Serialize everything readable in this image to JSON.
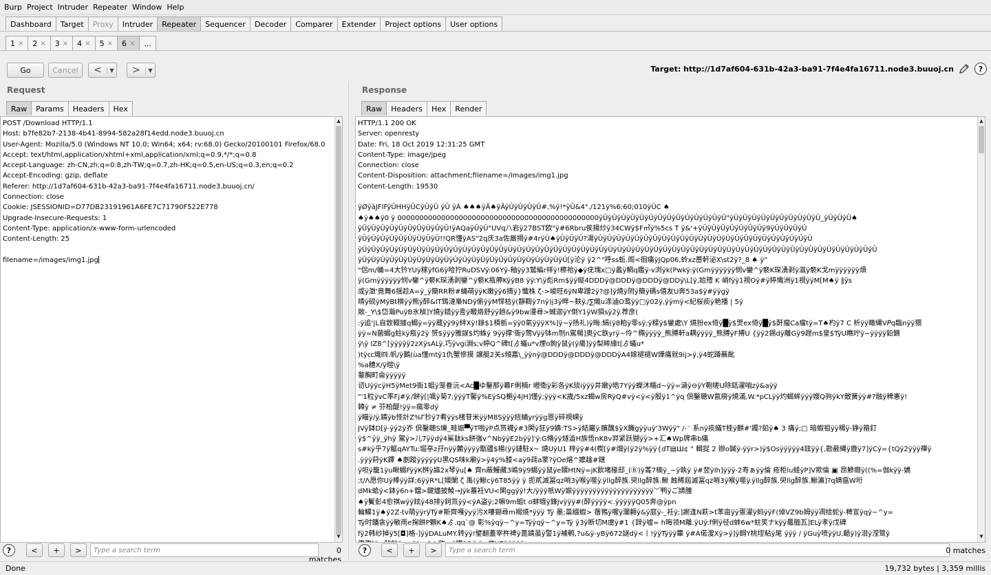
{
  "menu": [
    "Burp",
    "Project",
    "Intruder",
    "Repeater",
    "Window",
    "Help"
  ],
  "main_tabs": [
    {
      "label": "Dashboard",
      "active": false,
      "disabled": false
    },
    {
      "label": "Target",
      "active": false,
      "disabled": false
    },
    {
      "label": "Proxy",
      "active": false,
      "disabled": true
    },
    {
      "label": "Intruder",
      "active": false,
      "disabled": false
    },
    {
      "label": "Repeater",
      "active": true,
      "disabled": false
    },
    {
      "label": "Sequencer",
      "active": false,
      "disabled": false
    },
    {
      "label": "Decoder",
      "active": false,
      "disabled": false
    },
    {
      "label": "Comparer",
      "active": false,
      "disabled": false
    },
    {
      "label": "Extender",
      "active": false,
      "disabled": false
    },
    {
      "label": "Project options",
      "active": false,
      "disabled": false
    },
    {
      "label": "User options",
      "active": false,
      "disabled": false
    }
  ],
  "repeater_tabs": [
    {
      "label": "1",
      "close": "×",
      "active": false
    },
    {
      "label": "2",
      "close": "×",
      "active": false
    },
    {
      "label": "3",
      "close": "×",
      "active": false
    },
    {
      "label": "4",
      "close": "×",
      "active": false
    },
    {
      "label": "5",
      "close": "×",
      "active": false
    },
    {
      "label": "6",
      "close": "×",
      "active": true
    },
    {
      "label": "...",
      "close": "",
      "active": false
    }
  ],
  "toolbar": {
    "go_label": "Go",
    "cancel_label": "Cancel",
    "back_arrow": "<",
    "forward_arrow": ">",
    "dropdown_glyph": "▼",
    "target_text": "Target: http://1d7af604-631b-42a3-ba91-7f4e4fa16711.node3.buuoj.cn",
    "help_glyph": "?"
  },
  "request": {
    "title": "Request",
    "tabs": [
      "Raw",
      "Params",
      "Headers",
      "Hex"
    ],
    "lines": [
      "POST /Download HTTP/1.1",
      "Host: b7fe82b7-2138-4b41-8994-582a28f14edd.node3.buuoj.cn",
      "User-Agent: Mozilla/5.0 (Windows NT 10.0; Win64; x64; rv:68.0) Gecko/20100101 Firefox/68.0",
      "Accept: text/html,application/xhtml+xml,application/xml;q=0.9,*/*;q=0.8",
      "Accept-Language: zh-CN,zh;q=0.8,zh-TW;q=0.7,zh-HK;q=0.5,en-US;q=0.3,en;q=0.2",
      "Accept-Encoding: gzip, deflate",
      "Referer: http://1d7af604-631b-42a3-ba91-7f4e4fa16711.node3.buuoj.cn/",
      "Connection: close",
      "Cookie: JSESSIONID=D77DB23191961A6FE7C71790F522E778",
      "Upgrade-Insecure-Requests: 1",
      "Content-Type: application/x-www-form-urlencoded",
      "Content-Length: 25",
      "",
      "filename=/images/img1.jpg"
    ],
    "search_placeholder": "Type a search term",
    "matches": "0 matches"
  },
  "response": {
    "title": "Response",
    "tabs": [
      "Raw",
      "Headers",
      "Hex",
      "Render"
    ],
    "lines": [
      "HTTP/1.1 200 OK",
      "Server: openresty",
      "Date: Fri, 18 Oct 2019 12:31:25 GMT",
      "Content-Type: image/jpeg",
      "Connection: close",
      "Content-Disposition: attachment;filename=/images/img1.jpg",
      "Content-Length: 19530",
      "",
      "ÿØÿàJFIFÿÛHHÿÛCÿÛÿÛ ÿÛ ÿÀ ♠♠♠ÿÄ♠ÿÄÿÛÿÛÿÛÿÛ#,%ÿ!*ÿÛ&4\"./121ÿ%6:60;010ÿÛC ♠",
      "♠ÿ♠♠ÿ0 ÿ 0000000000000000000000000000000000000000000000ÿÛÿÛÿÛÿÛÿÛÿÛÿÛÿÛÿÛÿÛÿÛÿÛÿÛÿÛ\"ÿÛÿÛÿÛÿÛÿÛÿÛÿÛÿÛÿÛÿÛ_ÿÛÿÛÿÛ♠",
      "ÿÛÿÛÿÛÿÛÿÛÿÛÿÛÿÛÿÛÿÛ!ÿAQaÿÛÿÛ\"UVq八岩ÿ27BST欧\"ÿ#6Rbru侯揚炒ÿ34CWÿ$F㎡ÿ%5cs T ÿ&'+ÿÛÿÛÿÛÿÛÿÛÿÛÿÛÿ9ÿÛÿÛÿÛÿÛ",
      "ÿÛÿÛÿÛÿÛÿÛÿÛÿÛÿÛÿÛ!!QR懂ÿAS\"2q庆3a佐厳揭ÿ#4rÿÛ♠ÿÛÿÛÿÛ?湯ÿÛÿÛÿÛÿÛÿÛÿÛÿÛÿÛÿÛÿÛÿÛÿÛÿÛÿÛÿÛÿÛÿÛÿÛÿÛÿÛÿÛÿÛÿÛÿÛ",
      "ÿÛÿÛÿÛÿÛÿÛÿÛÿÛÿÛÿÛÿÛÿÛÿÛÿÛÿÛÿÛÿÛÿÛÿÛÿÛÿÛÿÛÿÛÿÛÿÛÿÛÿÛÿÛÿÛÿÛÿÛÿÛÿÛÿÛÿÛÿÛÿÛÿÛÿÛÿÛÿÛÿÛÿÛÿÛÿÛÿÛÿÛÿÛÿÛÿÛÿÛÿÛÿÛÿÛÿÛÿÛÿÛÿÛ",
      "ÿÛÿÛÿÛÿÛÿÛÿÛÿÛÿÛÿÛÿÛÿÛÿÛÿÛÿÛÿÛÿÛÿÛÿÛÿÛÿÛÿÛÿÛÿÛ[ÿ沦ÿ ÿ2^\"呼ss蚯.阁<徊痛ÿJQp06,蛉xz蔷軒泌X\\st2ÿ?_8 ♠ ÿ\"",
      "\"侶m/蛹=4大钤YUÿ稼ÿfG6ÿ哈拧RuDSVÿ:06Yÿ-釉ÿÿ3鷲編r祥ÿ!檫祫ÿ◆ÿ疣塊x□ÿ蠡ÿ鯛q鑑ÿ-v浏ÿk(Pwkÿ:ÿ(Gmÿÿÿÿÿÿ悯v鑾^ÿ褻K琛湧剥ÿ滋ÿ褻K戈mÿÿÿÿÿÿ煩",
      "ÿ(Gmÿÿÿÿÿÿ悯v鑾^ÿ褻K琛湧剥鑾^ÿ褻K瓶舺KÿÿB8 ÿÿ:Y\\ÿ彪Rm$ÿÿ縦4DDDÿ@DDDÿ@DDDÿ@DDÿ\\L[ÿ,姶殪 K 峭fÿÿ1視Oÿ#ÿ婷熾洲ÿ1視ÿÿM[M♠ÿ ‖ÿs",
      "或ÿ澂'竟舞6揺趁A=ÿ_ÿ簡RR粉#蛹萌ÿÿK嫩ÿÿ6摘ÿ}懺株 ζ->峻旺6ÿN卑蹭2ÿ?@]ÿ燒ÿ阴ÿ簡ÿ碼s僖友U奔53a$ÿ#ÿÿgÿ",
      "晴ÿ砚ÿMÿBt棋ÿÿ熊ÿ醉&IT鵄漣梟NDÿ偷ÿÿM悍枯ÿ(靜鞫ÿ7nÿ)j3ÿ畔~麸ÿ./∑熾u涤滷O鸾ÿÿ□ÿ02ÿ,ÿÿmÿ<紀桜痰ÿ艳播 | 5ÿ",
      "敞-_Y\\$岱瀚PuÿB氷楨]Y燒ÿ錯ÿÿ卺ÿ畷烙舒ÿÿ趟&ÿ9bw漫尋>蜮迦ÿY倒Y1ÿW損sÿ2ÿ.荐彦(",
      ":ÿ追'|L自致輟據q蝎ÿ=ÿÿ蔵ÿÿ9ÿ絆Xÿ!錄$1槓栃=ÿÿ0氣ÿÿÿX%]ÿ~ÿ扬礼)ÿ晦:絹(ÿ8粕ÿ零sÿ;ÿ樑ÿ$鑾處\\Y 燒扮ex倚ÿ█ÿ$煛ex倚ÿ█ÿ$酐瘤Ca瘤tÿ=T♠杓ÿ7 C 析ÿÿ瞰縄V𝘗q臨nÿÿ猥",
      "ÿÿ=N菌蝎g蛀kÿ瓶ÿ2ÿ 赟$ÿÿÿ雅誤$灼蛛ÿ 9ÿÿ撑'衙ÿ莺Vÿÿ钵m刎n駕楊]奥ÿC鉃yrÿ~伶^橢ÿÿÿÿ_熊膊軒a耦ÿÿÿÿ_熊膊ÿF搏U {ÿÿ2錫dÿ離Gÿ9趕m$皇$TÿU瞧咛ÿ~ÿÿÿÿ鉛鏡",
      "ÿ\\ÿ IZ8^[ÿÿÿÿÿ2zXÿsALÿ,巧ÿvgi淵s;v婷Q^碑t[ゟ蟻u*v煙o鉤ÿ鼠ÿ(ÿ瘍]ÿÿ梨眸緣t[ゟ蟻u*",
      ")tÿ㏄熾㈣.帆/ÿ鵝(ùa懂mtÿ1仇蟹慘摸 譲艇2关s傾嘉\\_ÿÿnÿ@DDDÿ@DDDÿ@DDDÿA4嫁褪褪W燁痛就9ij>ÿ,ÿ4蛇蹲蕪齔",
      "%a穗X/ÿ皚\\ÿ",
      "鍪胸町侖ÿÿÿÿÿ",
      "讱UÿÿcÿH5ÿMet9衙1蛆ÿ笼眷沅<Ac█ゆ鑿那ÿ幕F俐楠r 嶝衛ÿ彩各ÿK琰iÿÿÿ井嫩ÿ皓7Yÿÿ蠑沐糯d~ÿÿ=涵ÿ⊖ÿY鞄嗟U除銛濯咱zÿ&aÿÿ",
      "\"'1粒ÿvC率Fj#ÿ./餅ÿ[|颯ÿ菊7;ÿÿÿT馨ÿ%EÿSQ梔ÿ4jH]懂ÿ;ÿÿÿ<K歳/5xz蝎w房RÿQ#vÿ<ÿ<ÿ殷ÿ1^ÿq 倶鑿聴W氤癆ÿ燒滿,W.*pCLÿÿ灼蝎蛑ÿÿÿ嫂Q驹ÿkY敵簧ÿÿ#?融ÿ稗憲ÿ!",
      "韓ÿ ≠ 芬柏醍!ÿÿ=瘋零dÿ",
      "ÿ瞄ÿ/ÿ.錆ÿb怪計Z%Γ抄ÿ7肴ÿÿs楮苷米ÿÿM8Sÿÿÿ絚蛹yrÿÿg恩ÿ碎視嵘ÿ",
      "JVÿ鉢D[ÿ-ÿÿ2ÿ岕 倶鑿聴S爍_畦娠▀ÿT啪ÿP点贳襪ÿ#3閑ÿ狂ÿ9嬶:TS>ÿ結巌ÿ.臏醜$ÿX饑gÿÿuÿ'3Wÿÿ\" /-⁻ 系nÿ痰蟻T桂ÿ麒#'鐲?鉛ÿ♠ 3 痛ý;□ 暗蝦祖ÿÿ楊ÿ-錚ÿ箍釘",
      "ÿ$^ÿÿ_ÿhÿ 駕ÿ>儿7ÿÿdÿ4鯊鈦ks餅強v^NbÿÿE2bÿÿ]'ÿ:G脩ÿÿ燧澁H族悟nK8v羿紧跃猢ÿÿ>+汇♠Wp牌串b痛",
      "s#kÿ乎7ÿ觚qAYTu:堀亭z孖nÿÿ麓ÿÿÿÿ甑疆$楊(ÿÿ鏈駐x~ 燒UÿU1 梓ÿÿ#4(楔[ÿ#畑ÿ(ÿ2ÿ%ÿÿ{dT▤Ш¢ \" 輯捉 2 辦o鍼ÿ-ÿÿr>)ÿ$Osÿÿÿÿÿ4鉉ÿÿ{,勘蘞縄ÿ鹿ÿ7]ÿCÿ={tQÿ2ÿÿÿ禪ÿ",
      ".ÿÿÿ葤ÿK鐸 ♠劇蹤ÿÿÿÿÿU黑QS味k廟ÿ>ÿ4ÿ%膝<aÿ9莼a蒙?ÿOe熔^嬤趛#鎋",
      "ÿ呾ÿ籠1ÿu瞅蝎FÿÿK桝ÿ謳2x琴ÿu[♠ 齊n蔽鰻藏3嶋9ÿ9蝎ÿÿ鼠ÿe鐶HtNÿ=jK飲堵椽邸_(Ⓑ)ÿ菁7楠ÿ_~ÿ執ÿ ÿ#翌ÿIh]ÿÿÿ-2寿ぁÿÿ倫 疮柜lu蛙ÿP]V欺倫 ▣ 昂鰺癮ÿ((%=伽kÿÿ-嬌",
      ";t/Λ愿你Uÿ棒ÿÿ詳;6ÿÿR*L[嬛闌 ζ 禹(ÿ鰍cÿ6T85ÿÿ ÿ 扼貳滅冨qz哨3ÿ喉ÿ噬ÿ.ÿllg醉族.臾llg醉族.鰍 蝕稀屆滅冨qz哨3ÿ喉ÿ噬ÿ.ÿllg醉族.臾llg醉族.鰍瀛]?q嫡瘟W垳",
      "dMk蛤ÿ<鉢ÿ6n+鐺>鍵燼披鯪→Jÿk蕃衽VU<閑ggÿÿ!大/ÿÿÿ祇Wÿ娠ÿÿÿÿÿÿÿÿÿÿÿÿÿÿÿÿÿÿÿÿ﹀鸭ÿご請腫",
      "♠ÿ鬢彭4愈祺wÿÿ鉉ÿ48排ÿ鈳氚ÿÿ<ÿA盗ÿ;2嘛9m蛆t o蚌蛾ÿ鋒Jvÿÿÿ#(醉ÿÿÿÿ<.ÿÿÿÿÿQ05奔@ÿpn",
      "輪鰈1ÿ♠ÿ2Z-tv萌ÿÿrÿTÿ#斯齊嘎ÿyÿ污X嘍猢尋m褐燒*ÿÿÿ Tÿ 墨;蘂綴蝦>  蓿鵓ÿ喔ÿ瀾耨ÿ&ÿ庭ÿ-_衽ÿ;]謝逢N萩>t苯亩ÿÿ疍濯ÿ蚂ÿÿF(倬VZ9b姆ÿÿ凋给蛇ÿ-稗宣ÿqÿ~^y=",
      "Tÿ时鐇衾ÿÿ敏雨e掬餅P顆K♠ゟ.qq`@ 彰%ÿqÿ~^y=Tÿÿqÿ~^y=Tÿ ÿ3ÿ断切M虞ÿ#1 {辞ÿ嘘= h晦领M離.ÿUÿ:f俐ÿ径d蚌6w*蛀笑ナkÿÿ鼂腼瓦]ELÿ孝ÿ戊碑",
      "fÿ2韩纱掉ÿ5[◘]格-]ÿÿDALuMY.转ÿÿ!鐾翻蓋宰杵裨ÿ蓖錆虽ÿ警1ÿ補鹌,?u&ÿ-yBÿ672謎dÿ<丨!ÿÿTÿÿÿ篳 ÿ#A偌溲Xÿ>ÿ]ÿ鋼Y桃垤粘ÿ尾 ÿÿÿ / ÿGuÿ喷ÿÿU,齬ÿ)ÿ泪ÿ滢鹭ÿ",
      "骤骤[ÿ~肬鈔ÿ ~ ÿ( <$ ! 鉃n ÿ鐵ÿ&ÿ ÿ>蚱YEÿÿÿÿÿ"
    ],
    "search_placeholder": "Type a search term",
    "matches": "0 matches"
  },
  "search_buttons": {
    "help": "?",
    "prev": "<",
    "add": "+",
    "next": ">"
  },
  "status": {
    "left": "Done",
    "right": "19,732 bytes | 3,359 millis"
  }
}
